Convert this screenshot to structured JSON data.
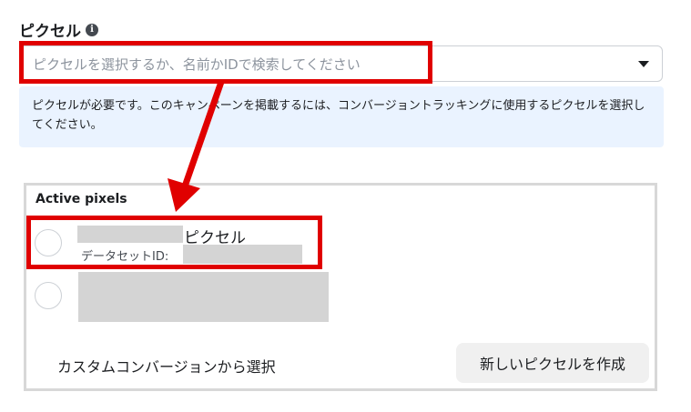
{
  "section": {
    "title": "ピクセル",
    "info_icon_glyph": "i"
  },
  "select": {
    "placeholder": "ピクセルを選択するか、名前かIDで検索してください"
  },
  "notice": {
    "text": "ピクセルが必要です。このキャンペーンを掲載するには、コンバージョントラッキングに使用するピクセルを選択してください。"
  },
  "pixels_panel": {
    "heading": "Active pixels",
    "items": [
      {
        "name_suffix": "ピクセル",
        "dataset_id_label": "データセットID:"
      }
    ],
    "custom_conversion_label": "カスタムコンバージョンから選択",
    "create_button_label": "新しいピクセルを作成"
  },
  "icons": {
    "info": "info-icon",
    "dropdown": "caret-down-icon"
  },
  "colors": {
    "highlight": "#e00000",
    "notice_bg": "#eaf3ff",
    "redaction": "#d4d4d4"
  }
}
